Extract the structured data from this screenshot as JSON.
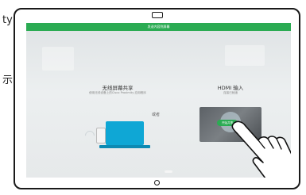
{
  "edge_text": {
    "a": "ty",
    "b": "示"
  },
  "screen": {
    "top_bar_label": "发送内容到屏幕",
    "wireless": {
      "title": "无线屏幕共享",
      "description": "使用无线设备上的Cisco Proximity 应用程序"
    },
    "or_label": "或者",
    "hdmi": {
      "title": "HDMI 输入",
      "description": "连接已就绪",
      "start_button": "开始共享"
    }
  },
  "colors": {
    "accent_green": "#2bab53",
    "laptop_blue": "#0fa7d5",
    "frame": "#1a1a1a"
  }
}
